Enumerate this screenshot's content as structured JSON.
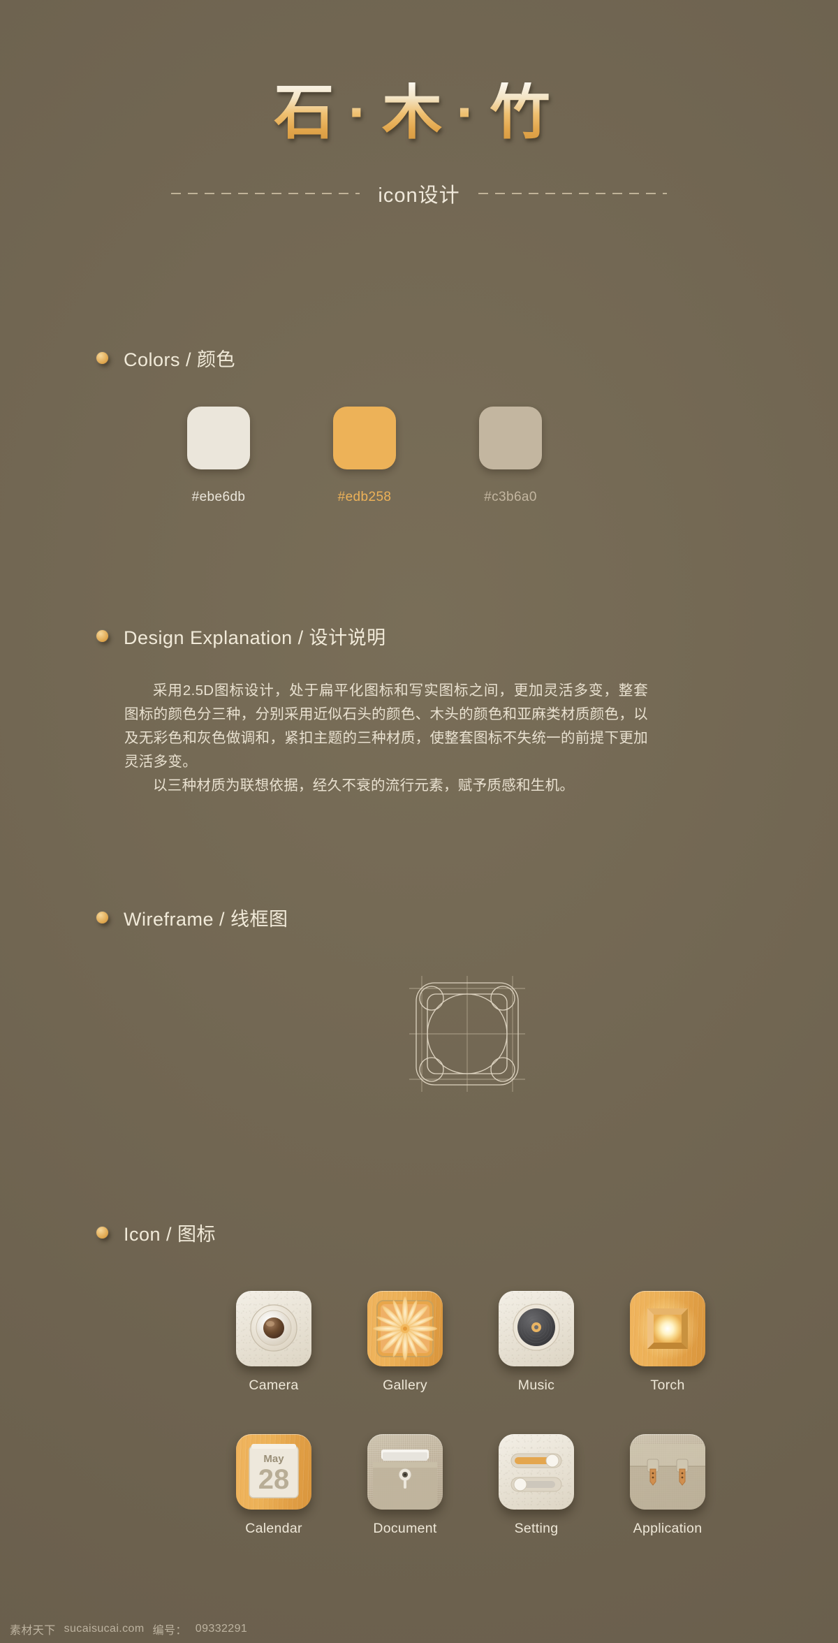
{
  "header": {
    "title": "石·木·竹",
    "subtitle": "icon设计"
  },
  "sections": {
    "colors": {
      "title": "Colors / 颜色",
      "swatches": [
        {
          "hex": "#ebe6db",
          "label": "#ebe6db"
        },
        {
          "hex": "#edb258",
          "label": "#edb258"
        },
        {
          "hex": "#c3b6a0",
          "label": "#c3b6a0"
        }
      ]
    },
    "explanation": {
      "title": "Design Explanation / 设计说明",
      "paragraphs": [
        "采用2.5D图标设计，处于扁平化图标和写实图标之间，更加灵活多变，整套图标的颜色分三种，分别采用近似石头的颜色、木头的颜色和亚麻类材质颜色，以及无彩色和灰色做调和，紧扣主题的三种材质，使整套图标不失统一的前提下更加灵活多变。",
        "以三种材质为联想依据，经久不衰的流行元素，赋予质感和生机。"
      ]
    },
    "wireframe": {
      "title": "Wireframe / 线框图"
    },
    "icons": {
      "title": "Icon / 图标",
      "items": [
        {
          "label": "Camera",
          "material": "stone",
          "icon": "camera-lens-icon"
        },
        {
          "label": "Gallery",
          "material": "wood",
          "icon": "flower-photo-icon"
        },
        {
          "label": "Music",
          "material": "stone",
          "icon": "vinyl-record-icon"
        },
        {
          "label": "Torch",
          "material": "wood",
          "icon": "glowing-frame-icon"
        },
        {
          "label": "Calendar",
          "material": "wood",
          "icon": "calendar-page-icon",
          "month": "May",
          "day": "28"
        },
        {
          "label": "Document",
          "material": "linen",
          "icon": "folder-lock-icon"
        },
        {
          "label": "Setting",
          "material": "stone",
          "icon": "toggle-sliders-icon"
        },
        {
          "label": "Application",
          "material": "linen",
          "icon": "briefcase-icon"
        }
      ]
    }
  },
  "watermark": {
    "site_cn": "素材天下",
    "site_url": "sucaisucai.com",
    "id_label": "编号：",
    "id_value": "09332291"
  },
  "theme": {
    "background": "#6e6350",
    "accent": "#edb258",
    "text": "#e8e1d2"
  }
}
